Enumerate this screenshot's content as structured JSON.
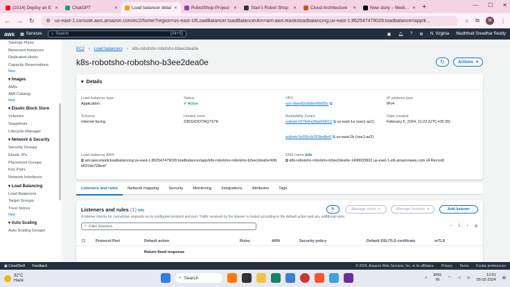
{
  "browser": {
    "tabs": [
      {
        "title": "(1014) Deploy an E",
        "color": "#ff0000"
      },
      {
        "title": "ChatGPT",
        "color": "#10a37f"
      },
      {
        "title": "Load balancer detai",
        "color": "#ff9900"
      },
      {
        "title": "RobotShop-Project",
        "color": "#8e44ad"
      },
      {
        "title": "Stan's Robot Shop",
        "color": "#333333"
      },
      {
        "title": "Cloud Architecture",
        "color": "#d35400"
      },
      {
        "title": "New story – Medium",
        "color": "#000000"
      }
    ],
    "url": "us-east-1.console.aws.amazon.com/ec2/home?region=us-east-1#LoadBalancer:loadBalancerArn=arn:aws:elasticloadbalancing:us-east-1:862547479026:loadbalancer/app/k..."
  },
  "aws_nav": {
    "logo": "aws",
    "services": "Services",
    "search_placeholder": "Search",
    "shortcut": "[Alt+S]",
    "region": "N. Virginia",
    "user": "Madhthati Sreedhar Reddy"
  },
  "sidebar": {
    "top_items": [
      "Savings Plans",
      "Reserved Instances",
      "Dedicated Hosts",
      "Capacity Reservations"
    ],
    "new_badge": "New",
    "sections": [
      {
        "title": "Images",
        "items": [
          "AMIs",
          "AMI Catalog"
        ]
      },
      {
        "title": "Elastic Block Store",
        "items": [
          "Volumes",
          "Snapshots",
          "Lifecycle Manager"
        ]
      },
      {
        "title": "Network & Security",
        "items": [
          "Security Groups",
          "Elastic IPs",
          "Placement Groups",
          "Key Pairs",
          "Network Interfaces"
        ]
      },
      {
        "title": "Load Balancing",
        "items": [
          "Load Balancers",
          "Target Groups",
          "Trust Stores"
        ]
      },
      {
        "title": "Auto Scaling",
        "items": [
          "Auto Scaling Groups"
        ]
      }
    ]
  },
  "breadcrumb": {
    "ec2": "EC2",
    "lbs": "Load balancers",
    "current": "k8s-robotsho-robotsho-b3ee2dea0e"
  },
  "page_title": "k8s-robotsho-robotsho-b3ee2dea0e",
  "actions_label": "Actions",
  "details": {
    "title": "Details",
    "lb_type_label": "Load balancer type",
    "lb_type": "Application",
    "status_label": "Status",
    "status": "Active",
    "vpc_label": "VPC",
    "vpc": "vpc-0bee82e8dbe06b05c",
    "ip_label": "IP address type",
    "ip": "IPv4",
    "scheme_label": "Scheme",
    "scheme": "Internet-facing",
    "zone_label": "Hosted zone",
    "zone": "Z35SXDOTRQ7X7K",
    "az_label": "Availability Zones",
    "az1_link": "subnet-027fefee2ba93d616",
    "az1_text": "us-east-1a (use1-az1)",
    "az2_link": "subnet-0c6f9ccb269befbe6",
    "az2_text": "us-east-1b (use1-az2)",
    "created_label": "Date created",
    "created": "February 5, 2024, 11:22 (UTC+05:30)",
    "arn_label": "Load balancer ARN",
    "arn": "arn:aws:elasticloadbalancing:us-east-1:862547479026:loadbalancer/app/k8s-robotsho-robotsho-b3ee2dea0e/40fcb637eb728ed7",
    "dns_label": "DNS name",
    "dns_info": "Info",
    "dns": "k8s-robotsho-robotsho-b3ee2dea0e-1498033902.us-east-1.elb.amazonaws.com (A Record)"
  },
  "tabs": [
    "Listeners and rules",
    "Network mapping",
    "Security",
    "Monitoring",
    "Integrations",
    "Attributes",
    "Tags"
  ],
  "listeners": {
    "title": "Listeners and rules",
    "count": "(1)",
    "info": "Info",
    "desc": "A listener checks for connection requests on its configured protocol and port. Traffic received by the listener is routed according to the default action and any additional rules.",
    "manage_rules": "Manage rules",
    "manage_listener": "Manage listener",
    "add_listener": "Add listener",
    "filter_placeholder": "Filter listeners",
    "page": "1",
    "columns": [
      "Protocol:Port",
      "Default action",
      "Rules",
      "ARN",
      "Security policy",
      "Default SSL/TLS certificate",
      "mTLS"
    ],
    "row_action": "Return fixed response"
  },
  "footer": {
    "cloudshell": "CloudShell",
    "feedback": "Feedback",
    "copyright": "© 2024, Amazon Web Services, Inc. or its affiliates.",
    "privacy": "Privacy",
    "terms": "Terms",
    "cookies": "Cookie preferences"
  },
  "taskbar": {
    "temp": "32°C",
    "weather": "Haze",
    "search": "Search",
    "lang1": "ENG",
    "lang2": "IN",
    "time": "12:51",
    "date": "05-02-2024"
  }
}
